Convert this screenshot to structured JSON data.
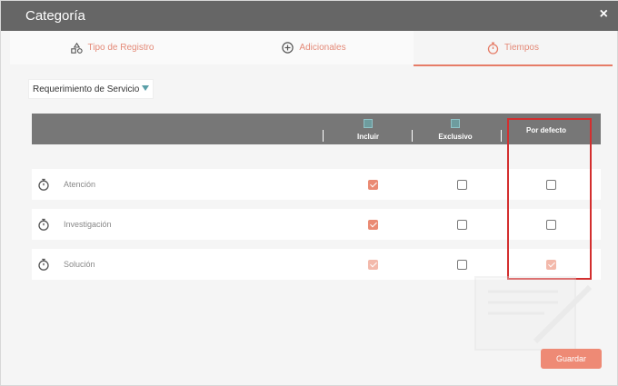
{
  "modal": {
    "title": "Categoría",
    "close_symbol": "×"
  },
  "tabs": [
    {
      "label": "Tipo de Registro",
      "icon": "shapes-icon",
      "active": false
    },
    {
      "label": "Adicionales",
      "icon": "plus-circle-icon",
      "active": false
    },
    {
      "label": "Tiempos",
      "icon": "stopwatch-icon",
      "active": true
    }
  ],
  "dropdown": {
    "selected": "Requerimiento de Servicio"
  },
  "table": {
    "columns": [
      "Incluir",
      "Exclusivo",
      "Por defecto"
    ],
    "header_checkboxes": {
      "Incluir": false,
      "Exclusivo": false
    },
    "rows": [
      {
        "label": "Atención",
        "icon": "stopwatch-icon",
        "incluir": true,
        "exclusivo": false,
        "por_defecto": false
      },
      {
        "label": "Investigación",
        "icon": "stopwatch-icon",
        "incluir": true,
        "exclusivo": false,
        "por_defecto": false
      },
      {
        "label": "Solución",
        "icon": "stopwatch-icon",
        "incluir": true,
        "exclusivo": false,
        "por_defecto": true
      }
    ]
  },
  "footer": {
    "save_label": "Guardar"
  },
  "colors": {
    "accent": "#ea8a73",
    "header_bg": "#666666",
    "table_header_bg": "#777777",
    "highlight_border": "#d32f2f"
  }
}
